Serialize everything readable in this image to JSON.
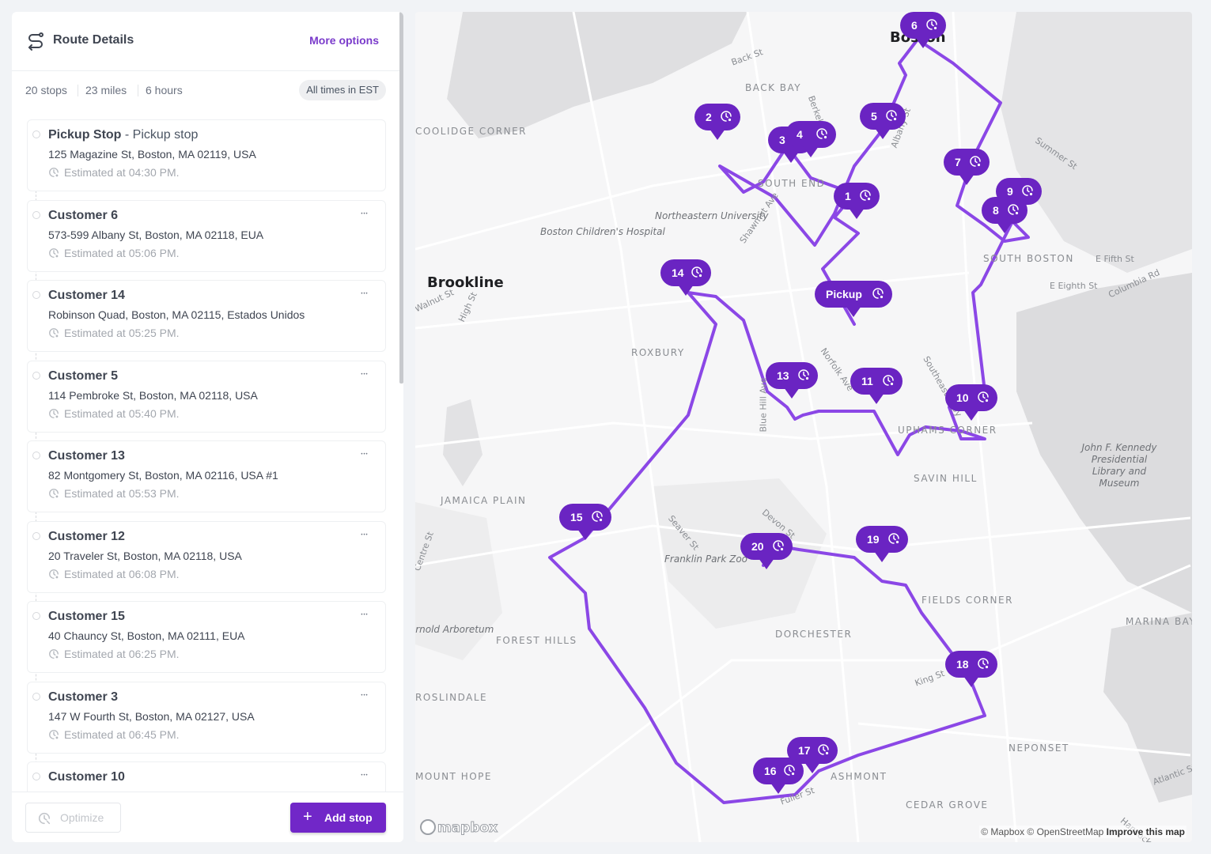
{
  "sidebar": {
    "title": "Route Details",
    "more_options": "More options",
    "stats": {
      "stops": "20 stops",
      "miles": "23 miles",
      "hours": "6 hours",
      "timezone": "All times in EST"
    },
    "stops": [
      {
        "name": "Pickup Stop",
        "subtitle": " - Pickup stop",
        "address": "125 Magazine St, Boston, MA 02119, USA",
        "eta": "Estimated at 04:30 PM.",
        "has_menu": false
      },
      {
        "name": "Customer 6",
        "address": "573-599 Albany St, Boston, MA 02118, EUA",
        "eta": "Estimated at 05:06 PM.",
        "has_menu": true
      },
      {
        "name": "Customer 14",
        "address": "Robinson Quad, Boston, MA 02115, Estados Unidos",
        "eta": "Estimated at 05:25 PM.",
        "has_menu": true
      },
      {
        "name": "Customer 5",
        "address": "114 Pembroke St, Boston, MA 02118, USA",
        "eta": "Estimated at 05:40 PM.",
        "has_menu": true
      },
      {
        "name": "Customer 13",
        "address": "82 Montgomery St, Boston, MA 02116, USA #1",
        "eta": "Estimated at 05:53 PM.",
        "has_menu": true
      },
      {
        "name": "Customer 12",
        "address": "20 Traveler St, Boston, MA 02118, USA",
        "eta": "Estimated at 06:08 PM.",
        "has_menu": true
      },
      {
        "name": "Customer 15",
        "address": "40 Chauncy St, Boston, MA 02111, EUA",
        "eta": "Estimated at 06:25 PM.",
        "has_menu": true
      },
      {
        "name": "Customer 3",
        "address": "147 W Fourth St, Boston, MA 02127, USA",
        "eta": "Estimated at 06:45 PM.",
        "has_menu": true
      },
      {
        "name": "Customer 10",
        "address": "",
        "eta": "",
        "has_menu": true
      }
    ],
    "footer": {
      "optimize": "Optimize",
      "add_stop": "Add stop"
    }
  },
  "map": {
    "route_color": "#8b47e6",
    "marker_color": "#6a24c2",
    "city_labels": [
      "Boston",
      "Brookline"
    ],
    "neighborhood_labels": [
      "BACK BAY",
      "SOUTH END",
      "COOLIDGE CORNER",
      "ROXBURY",
      "SOUTH BOSTON",
      "JAMAICA PLAIN",
      "UPHAMS CORNER",
      "SAVIN HILL",
      "FIELDS CORNER",
      "DORCHESTER",
      "FOREST HILLS",
      "ROSLINDALE",
      "MOUNT HOPE",
      "ASHMONT",
      "CEDAR GROVE",
      "NEPONSET",
      "MARINA BAY"
    ],
    "poi_labels": [
      "Northeastern University",
      "Boston Children's Hospital",
      "Franklin Park Zoo",
      "Arnold Arboretum",
      "John F. Kennedy Presidential Library and Museum"
    ],
    "street_labels": [
      "Back St",
      "Berkeley St",
      "Albany St",
      "Summer St",
      "Shawmut Ave",
      "Norfolk Ave",
      "Southeast Expy",
      "Walnut St",
      "High St",
      "E Fifth St",
      "E Eighth St",
      "Columbia Rd",
      "Blue Hill Ave",
      "Seaver St",
      "Devon St",
      "Centre St",
      "King St",
      "Fuller St",
      "Atlantic St",
      "Hancock St"
    ],
    "markers": [
      "6",
      "2",
      "3",
      "4",
      "5",
      "1",
      "7",
      "9",
      "8",
      "14",
      "Pickup",
      "13",
      "11",
      "10",
      "15",
      "20",
      "19",
      "18",
      "17",
      "16"
    ],
    "logo": "mapbox",
    "attribution": "© Mapbox © OpenStreetMap",
    "improve_link": "Improve this map"
  }
}
